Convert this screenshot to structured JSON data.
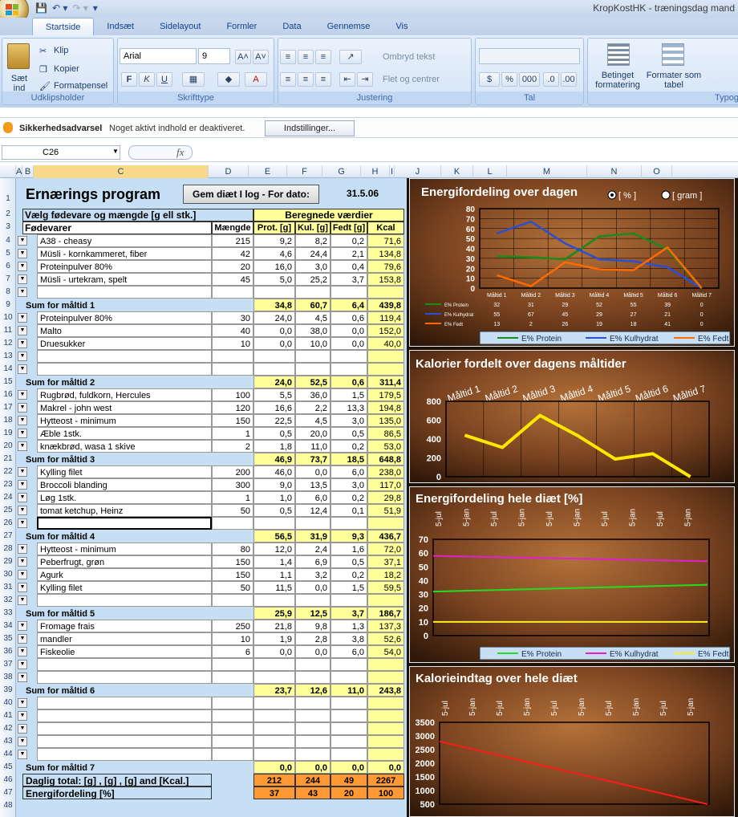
{
  "window": {
    "title": "KropKostHK - træningsdag mand"
  },
  "tabs": [
    "Startside",
    "Indsæt",
    "Sidelayout",
    "Formler",
    "Data",
    "Gennemse",
    "Vis"
  ],
  "ribbon": {
    "clipboard": {
      "paste": "Sæt ind",
      "cut": "Klip",
      "copy": "Kopier",
      "format_painter": "Formatpensel",
      "label": "Udklipsholder"
    },
    "font": {
      "name": "Arial",
      "size": "9",
      "label": "Skrifttype",
      "bold": "F",
      "italic": "K",
      "underline": "U"
    },
    "alignment": {
      "wrap": "Ombryd tekst",
      "merge": "Flet og centrer",
      "label": "Justering"
    },
    "number": {
      "label": "Tal",
      "percent": "%",
      "thousands": "000"
    },
    "styles": {
      "conditional": "Betinget formatering",
      "table": "Formater som tabel",
      "label": "Typog"
    }
  },
  "security": {
    "title": "Sikkerhedsadvarsel",
    "message": "Noget aktivt indhold er deaktiveret.",
    "button": "Indstillinger..."
  },
  "formula_bar": {
    "name_box": "C26",
    "fx": "fx"
  },
  "columns": [
    "A",
    "B",
    "C",
    "D",
    "E",
    "F",
    "G",
    "H",
    "I",
    "J",
    "K",
    "L",
    "M",
    "N",
    "O"
  ],
  "sheet": {
    "title": "Ernærings program",
    "log_button": "Gem diæt I log - For dato:",
    "date": "31.5.06",
    "select_label": "Vælg fødevare og mængde [g ell stk.]",
    "calc_label": "Beregnede værdier",
    "headers": [
      "Fødevarer",
      "Mængde",
      "Prot. [g]",
      "Kul. [g]",
      "Fedt [g]",
      "Kcal"
    ],
    "rows": [
      {
        "r": "4",
        "t": "food",
        "c": [
          "A38 - cheasy",
          "215",
          "9,2",
          "8,2",
          "0,2",
          "71,6"
        ]
      },
      {
        "r": "5",
        "t": "food",
        "c": [
          "Müsli - kornkammeret, fiber",
          "42",
          "4,6",
          "24,4",
          "2,1",
          "134,8"
        ]
      },
      {
        "r": "6",
        "t": "food",
        "c": [
          "Proteinpulver 80%",
          "20",
          "16,0",
          "3,0",
          "0,4",
          "79,6"
        ]
      },
      {
        "r": "7",
        "t": "food",
        "c": [
          "Müsli - urtekram, spelt",
          "45",
          "5,0",
          "25,2",
          "3,7",
          "153,8"
        ]
      },
      {
        "r": "8",
        "t": "food",
        "c": [
          "",
          "",
          "",
          "",
          "",
          ""
        ]
      },
      {
        "r": "9",
        "t": "sum",
        "c": [
          "Sum for måltid 1",
          "",
          "34,8",
          "60,7",
          "6,4",
          "439,8"
        ]
      },
      {
        "r": "10",
        "t": "food",
        "c": [
          "Proteinpulver 80%",
          "30",
          "24,0",
          "4,5",
          "0,6",
          "119,4"
        ]
      },
      {
        "r": "11",
        "t": "food",
        "c": [
          "Malto",
          "40",
          "0,0",
          "38,0",
          "0,0",
          "152,0"
        ]
      },
      {
        "r": "12",
        "t": "food",
        "c": [
          "Druesukker",
          "10",
          "0,0",
          "10,0",
          "0,0",
          "40,0"
        ]
      },
      {
        "r": "13",
        "t": "food",
        "c": [
          "",
          "",
          "",
          "",
          "",
          ""
        ]
      },
      {
        "r": "14",
        "t": "food",
        "c": [
          "",
          "",
          "",
          "",
          "",
          ""
        ]
      },
      {
        "r": "15",
        "t": "sum",
        "c": [
          "Sum for måltid 2",
          "",
          "24,0",
          "52,5",
          "0,6",
          "311,4"
        ]
      },
      {
        "r": "16",
        "t": "food",
        "c": [
          "Rugbrød, fuldkorn, Hercules",
          "100",
          "5,5",
          "36,0",
          "1,5",
          "179,5"
        ]
      },
      {
        "r": "17",
        "t": "food",
        "c": [
          "Makrel - john west",
          "120",
          "16,6",
          "2,2",
          "13,3",
          "194,8"
        ]
      },
      {
        "r": "18",
        "t": "food",
        "c": [
          "Hytteost - minimum",
          "150",
          "22,5",
          "4,5",
          "3,0",
          "135,0"
        ]
      },
      {
        "r": "19",
        "t": "food",
        "c": [
          "Æble 1stk.",
          "1",
          "0,5",
          "20,0",
          "0,5",
          "86,5"
        ]
      },
      {
        "r": "20",
        "t": "food",
        "c": [
          "knækbrød, wasa 1 skive",
          "2",
          "1,8",
          "11,0",
          "0,2",
          "53,0"
        ]
      },
      {
        "r": "21",
        "t": "sum",
        "c": [
          "Sum for måltid 3",
          "",
          "46,9",
          "73,7",
          "18,5",
          "648,8"
        ]
      },
      {
        "r": "22",
        "t": "food",
        "c": [
          "Kylling filet",
          "200",
          "46,0",
          "0,0",
          "6,0",
          "238,0"
        ]
      },
      {
        "r": "23",
        "t": "food",
        "c": [
          "Broccoli blanding",
          "300",
          "9,0",
          "13,5",
          "3,0",
          "117,0"
        ]
      },
      {
        "r": "24",
        "t": "food",
        "c": [
          "Løg 1stk.",
          "1",
          "1,0",
          "6,0",
          "0,2",
          "29,8"
        ]
      },
      {
        "r": "25",
        "t": "food",
        "c": [
          "tomat ketchup, Heinz",
          "50",
          "0,5",
          "12,4",
          "0,1",
          "51,9"
        ]
      },
      {
        "r": "26",
        "t": "active",
        "c": [
          "",
          "",
          "",
          "",
          "",
          ""
        ]
      },
      {
        "r": "27",
        "t": "sum",
        "c": [
          "Sum for måltid 4",
          "",
          "56,5",
          "31,9",
          "9,3",
          "436,7"
        ]
      },
      {
        "r": "28",
        "t": "food",
        "c": [
          "Hytteost - minimum",
          "80",
          "12,0",
          "2,4",
          "1,6",
          "72,0"
        ]
      },
      {
        "r": "29",
        "t": "food",
        "c": [
          "Peberfrugt, grøn",
          "150",
          "1,4",
          "6,9",
          "0,5",
          "37,1"
        ]
      },
      {
        "r": "30",
        "t": "food",
        "c": [
          "Agurk",
          "150",
          "1,1",
          "3,2",
          "0,2",
          "18,2"
        ]
      },
      {
        "r": "31",
        "t": "food",
        "c": [
          "Kylling filet",
          "50",
          "11,5",
          "0,0",
          "1,5",
          "59,5"
        ]
      },
      {
        "r": "32",
        "t": "food",
        "c": [
          "",
          "",
          "",
          "",
          "",
          ""
        ]
      },
      {
        "r": "33",
        "t": "sum",
        "c": [
          "Sum for måltid 5",
          "",
          "25,9",
          "12,5",
          "3,7",
          "186,7"
        ]
      },
      {
        "r": "34",
        "t": "food",
        "c": [
          "Fromage frais",
          "250",
          "21,8",
          "9,8",
          "1,3",
          "137,3"
        ]
      },
      {
        "r": "35",
        "t": "food",
        "c": [
          "mandler",
          "10",
          "1,9",
          "2,8",
          "3,8",
          "52,6"
        ]
      },
      {
        "r": "36",
        "t": "food",
        "c": [
          "Fiskeolie",
          "6",
          "0,0",
          "0,0",
          "6,0",
          "54,0"
        ]
      },
      {
        "r": "37",
        "t": "food",
        "c": [
          "",
          "",
          "",
          "",
          "",
          ""
        ]
      },
      {
        "r": "38",
        "t": "food",
        "c": [
          "",
          "",
          "",
          "",
          "",
          ""
        ]
      },
      {
        "r": "39",
        "t": "sum",
        "c": [
          "Sum for måltid 6",
          "",
          "23,7",
          "12,6",
          "11,0",
          "243,8"
        ]
      },
      {
        "r": "40",
        "t": "food",
        "c": [
          "",
          "",
          "",
          "",
          "",
          ""
        ]
      },
      {
        "r": "41",
        "t": "food",
        "c": [
          "",
          "",
          "",
          "",
          "",
          ""
        ]
      },
      {
        "r": "42",
        "t": "food",
        "c": [
          "",
          "",
          "",
          "",
          "",
          ""
        ]
      },
      {
        "r": "43",
        "t": "food",
        "c": [
          "",
          "",
          "",
          "",
          "",
          ""
        ]
      },
      {
        "r": "44",
        "t": "food",
        "c": [
          "",
          "",
          "",
          "",
          "",
          ""
        ]
      },
      {
        "r": "45",
        "t": "sum",
        "c": [
          "Sum for måltid 7",
          "",
          "0,0",
          "0,0",
          "0,0",
          "0,0"
        ]
      },
      {
        "r": "46",
        "t": "total",
        "c": [
          "Daglig total: [g] , [g] , [g] and [Kcal.]",
          "",
          "212",
          "244",
          "49",
          "2267"
        ]
      },
      {
        "r": "47",
        "t": "total",
        "c": [
          "Energifordeling  [%]",
          "",
          "37",
          "43",
          "20",
          "100"
        ]
      }
    ],
    "last_row": "48"
  },
  "chart_data": [
    {
      "type": "line",
      "title": "Energifordeling over dagen",
      "options": [
        "[ % ]",
        "[ gram ]"
      ],
      "categories": [
        "Måltid 1",
        "Måltid 2",
        "Måltid 3",
        "Måltid 4",
        "Måltid 5",
        "Måltid 6",
        "Måltid 7"
      ],
      "ylim": [
        0,
        80
      ],
      "yticks": [
        "80",
        "70",
        "60",
        "50",
        "40",
        "30",
        "20",
        "10",
        "0"
      ],
      "series": [
        {
          "name": "E% Protein",
          "color": "#1a8a1a",
          "values": [
            32,
            31,
            29,
            52,
            55,
            39,
            0
          ],
          "labels": [
            "32",
            "31",
            "29",
            "52",
            "55",
            "39",
            "0"
          ]
        },
        {
          "name": "E% Kulhydrat",
          "color": "#2a4fd0",
          "values": [
            55,
            67,
            45,
            29,
            27,
            21,
            0
          ],
          "labels": [
            "55",
            "67",
            "45",
            "29",
            "27",
            "21",
            "0"
          ]
        },
        {
          "name": "E% Fedt",
          "color": "#ff6a00",
          "values": [
            13,
            2,
            26,
            19,
            18,
            41,
            0
          ],
          "labels": [
            "13",
            "2",
            "26",
            "19",
            "18",
            "41",
            "0"
          ]
        }
      ]
    },
    {
      "type": "line",
      "title": "Kalorier fordelt over dagens måltider",
      "categories": [
        "Måltid 1",
        "Måltid 2",
        "Måltid 3",
        "Måltid 4",
        "Måltid 5",
        "Måltid 6",
        "Måltid 7"
      ],
      "ylim": [
        0,
        800
      ],
      "yticks": [
        "800",
        "600",
        "400",
        "200",
        "0"
      ],
      "series": [
        {
          "name": "Kcal",
          "color": "#ffe800",
          "values": [
            440,
            311,
            649,
            437,
            187,
            244,
            0
          ]
        }
      ]
    },
    {
      "type": "line",
      "title": "Energifordeling hele diæt [%]",
      "categories": [
        "5-jul",
        "5-jan",
        "5-jul",
        "5-jan",
        "5-jul",
        "5-jan",
        "5-jul",
        "5-jan",
        "5-jul",
        "5-jan"
      ],
      "ylim": [
        0,
        70
      ],
      "yticks": [
        "70",
        "60",
        "50",
        "40",
        "30",
        "20",
        "10",
        "0"
      ],
      "series": [
        {
          "name": "E% Protein",
          "color": "#22dd22",
          "values": [
            32,
            37
          ]
        },
        {
          "name": "E% Kulhydrat",
          "color": "#e020d0",
          "values": [
            58,
            54
          ]
        },
        {
          "name": "E% Fedt",
          "color": "#ffee22",
          "values": [
            10,
            10
          ]
        }
      ]
    },
    {
      "type": "line",
      "title": "Kalorieindtag over hele diæt",
      "categories": [
        "5-jul",
        "5-jan",
        "5-jul",
        "5-jan",
        "5-jul",
        "5-jan",
        "5-jul",
        "5-jan",
        "5-jul",
        "5-jan"
      ],
      "ylim": [
        500,
        3500
      ],
      "yticks": [
        "3500",
        "3000",
        "2500",
        "2000",
        "1500",
        "1000",
        "500"
      ],
      "series": [
        {
          "name": "Kcal",
          "color": "#ff1a1a",
          "values": [
            2800,
            500
          ]
        }
      ]
    }
  ]
}
